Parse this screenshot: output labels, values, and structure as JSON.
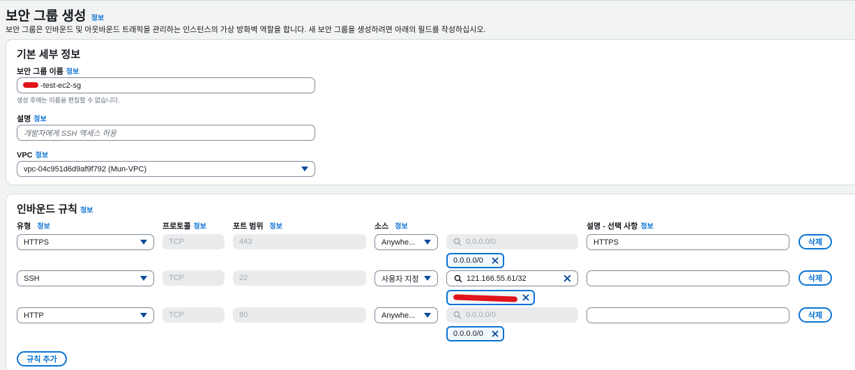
{
  "page": {
    "title": "보안 그룹 생성",
    "info": "정보",
    "description": "보안 그룹은 인바운드 및 아웃바운드 트래픽을 관리하는 인스턴스의 가상 방화벽 역할을 합니다. 새 보안 그룹을 생성하려면 아래의 필드를 작성하십시오."
  },
  "basic": {
    "title": "기본 세부 정보",
    "name_label": "보안 그룹 이름",
    "name_value": "-test-ec2-sg",
    "name_hint": "생성 후에는 이름을 편집할 수 없습니다.",
    "desc_label": "설명",
    "desc_placeholder": "개발자에게 SSH 액세스 허용",
    "vpc_label": "VPC",
    "vpc_value": "vpc-04c951d6d9af9f792 (Mun-VPC)"
  },
  "inbound": {
    "title": "인바운드 규칙",
    "headers": {
      "type": "유형",
      "protocol": "프로토콜",
      "port": "포트 범위",
      "source": "소스",
      "desc": "설명 - 선택 사항"
    },
    "rules": [
      {
        "type": "HTTPS",
        "protocol": "TCP",
        "port": "443",
        "source": "Anywhe...",
        "search": "0.0.0.0/0",
        "token": "0.0.0.0/0",
        "desc": "HTTPS",
        "delete": "삭제"
      },
      {
        "type": "SSH",
        "protocol": "TCP",
        "port": "22",
        "source": "사용자 지정",
        "search": "121.166.55.61/32",
        "token": "",
        "desc": "",
        "delete": "삭제"
      },
      {
        "type": "HTTP",
        "protocol": "TCP",
        "port": "80",
        "source": "Anywhe...",
        "search": "0.0.0.0/0",
        "token": "0.0.0.0/0",
        "desc": "",
        "delete": "삭제"
      }
    ],
    "add_rule": "규칙 추가"
  },
  "colors": {
    "accent": "#0972d3",
    "redaction": "#e0141a"
  },
  "icons": [
    "info-link",
    "caret-down-icon",
    "search-icon",
    "close-icon"
  ]
}
